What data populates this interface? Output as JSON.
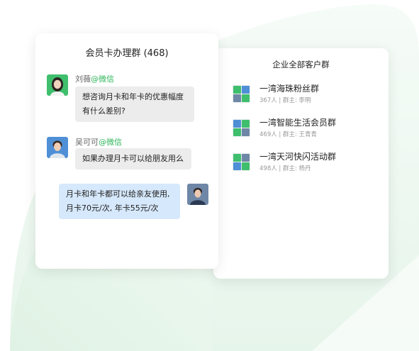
{
  "chat": {
    "title": "会员卡办理群 (468)",
    "messages": [
      {
        "sender": "刘薇",
        "tag": "@微信",
        "lines": [
          "想咨询月卡和年卡的优惠幅度",
          "有什么差别?"
        ]
      },
      {
        "sender": "吴可可",
        "tag": "@微信",
        "lines": [
          "如果办理月卡可以给朋友用么"
        ]
      },
      {
        "sender": "",
        "tag": "",
        "lines": [
          "月卡和年卡都可以给亲友使用,",
          "月卡70元/次, 年卡55元/次"
        ]
      }
    ]
  },
  "groups": {
    "title": "企业全部客户群",
    "items": [
      {
        "name": "一湾海珠粉丝群",
        "meta": "367人 | 群主: 李明"
      },
      {
        "name": "一湾智能生活会员群",
        "meta": "469人 | 群主: 王青青"
      },
      {
        "name": "一湾天河快闪活动群",
        "meta": "498人 | 群主: 杨丹"
      }
    ]
  },
  "colors": {
    "accent_green": "#2fb55a",
    "bubble_blue": "#d6e8fb",
    "bubble_grey": "#ececec"
  },
  "icons": [
    "avatar-woman-green",
    "avatar-man-blue",
    "avatar-woman-dark",
    "group-avatar-grid"
  ]
}
